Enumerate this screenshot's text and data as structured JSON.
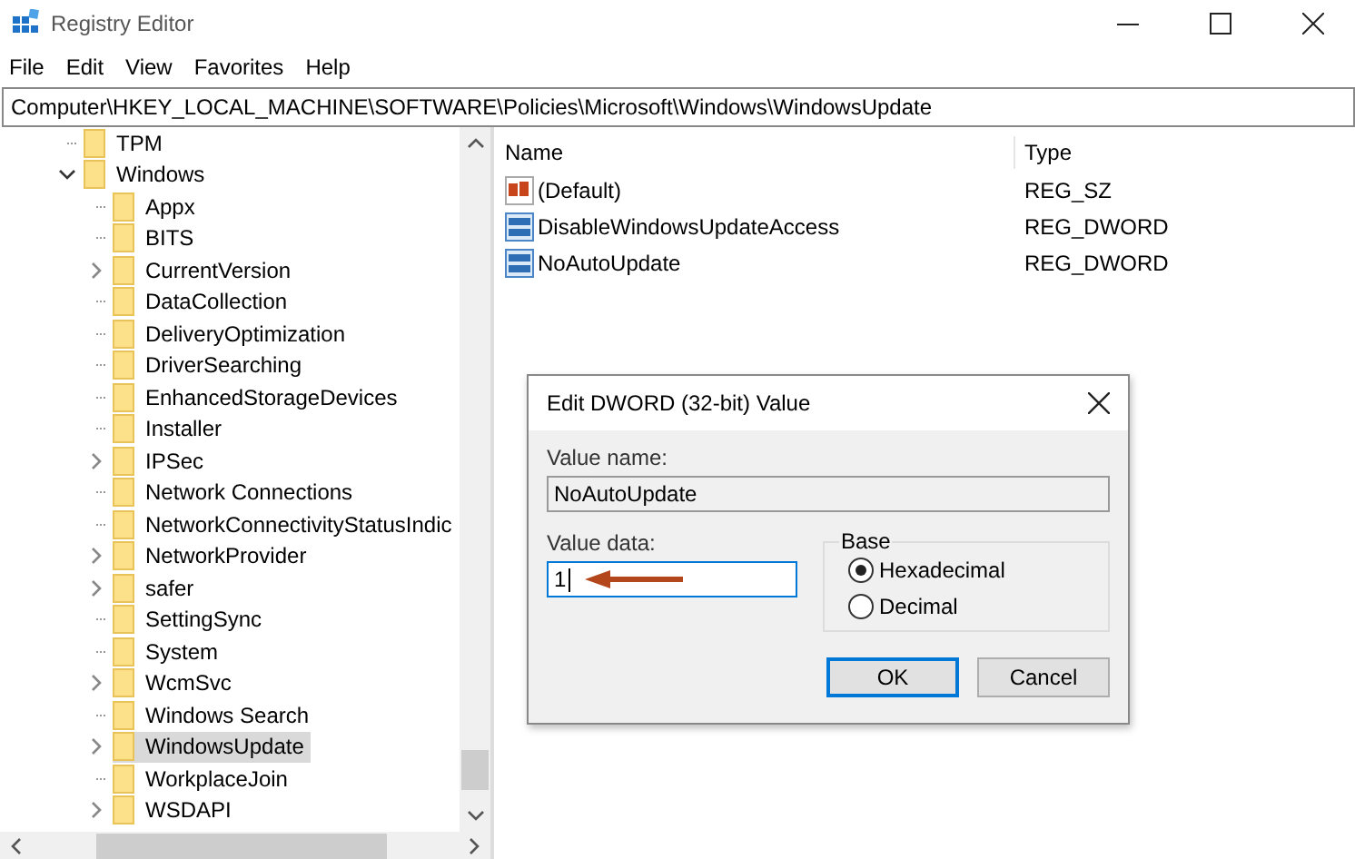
{
  "window": {
    "title": "Registry Editor"
  },
  "menu": [
    "File",
    "Edit",
    "View",
    "Favorites",
    "Help"
  ],
  "address": "Computer\\HKEY_LOCAL_MACHINE\\SOFTWARE\\Policies\\Microsoft\\Windows\\WindowsUpdate",
  "tree": [
    {
      "label": "TPM",
      "kind": "leaf",
      "selected": false
    },
    {
      "label": "Windows",
      "kind": "expanded",
      "selected": false,
      "children": [
        {
          "label": "Appx",
          "kind": "leaf",
          "selected": false
        },
        {
          "label": "BITS",
          "kind": "leaf",
          "selected": false
        },
        {
          "label": "CurrentVersion",
          "kind": "collapsed",
          "selected": false
        },
        {
          "label": "DataCollection",
          "kind": "leaf",
          "selected": false
        },
        {
          "label": "DeliveryOptimization",
          "kind": "leaf",
          "selected": false
        },
        {
          "label": "DriverSearching",
          "kind": "leaf",
          "selected": false
        },
        {
          "label": "EnhancedStorageDevices",
          "kind": "leaf",
          "selected": false
        },
        {
          "label": "Installer",
          "kind": "leaf",
          "selected": false
        },
        {
          "label": "IPSec",
          "kind": "collapsed",
          "selected": false
        },
        {
          "label": "Network Connections",
          "kind": "leaf",
          "selected": false
        },
        {
          "label": "NetworkConnectivityStatusIndic",
          "kind": "leaf",
          "selected": false
        },
        {
          "label": "NetworkProvider",
          "kind": "collapsed",
          "selected": false
        },
        {
          "label": "safer",
          "kind": "collapsed",
          "selected": false
        },
        {
          "label": "SettingSync",
          "kind": "leaf",
          "selected": false
        },
        {
          "label": "System",
          "kind": "leaf",
          "selected": false
        },
        {
          "label": "WcmSvc",
          "kind": "collapsed",
          "selected": false
        },
        {
          "label": "Windows Search",
          "kind": "leaf",
          "selected": false
        },
        {
          "label": "WindowsUpdate",
          "kind": "collapsed",
          "selected": true
        },
        {
          "label": "WorkplaceJoin",
          "kind": "leaf",
          "selected": false
        },
        {
          "label": "WSDAPI",
          "kind": "collapsed",
          "selected": false
        }
      ]
    }
  ],
  "values": {
    "columns": [
      "Name",
      "Type"
    ],
    "rows": [
      {
        "kind": "string",
        "name": "(Default)",
        "type": "REG_SZ"
      },
      {
        "kind": "binary",
        "name": "DisableWindowsUpdateAccess",
        "type": "REG_DWORD"
      },
      {
        "kind": "binary",
        "name": "NoAutoUpdate",
        "type": "REG_DWORD"
      }
    ]
  },
  "dialog": {
    "title": "Edit DWORD (32-bit) Value",
    "value_name_label": "Value name:",
    "value_name": "NoAutoUpdate",
    "value_data_label": "Value data:",
    "value_data": "1",
    "base_label": "Base",
    "base_options": [
      {
        "label": "Hexadecimal",
        "selected": true
      },
      {
        "label": "Decimal",
        "selected": false
      }
    ],
    "buttons": [
      {
        "label": "OK",
        "default": true
      },
      {
        "label": "Cancel",
        "default": false
      }
    ]
  }
}
